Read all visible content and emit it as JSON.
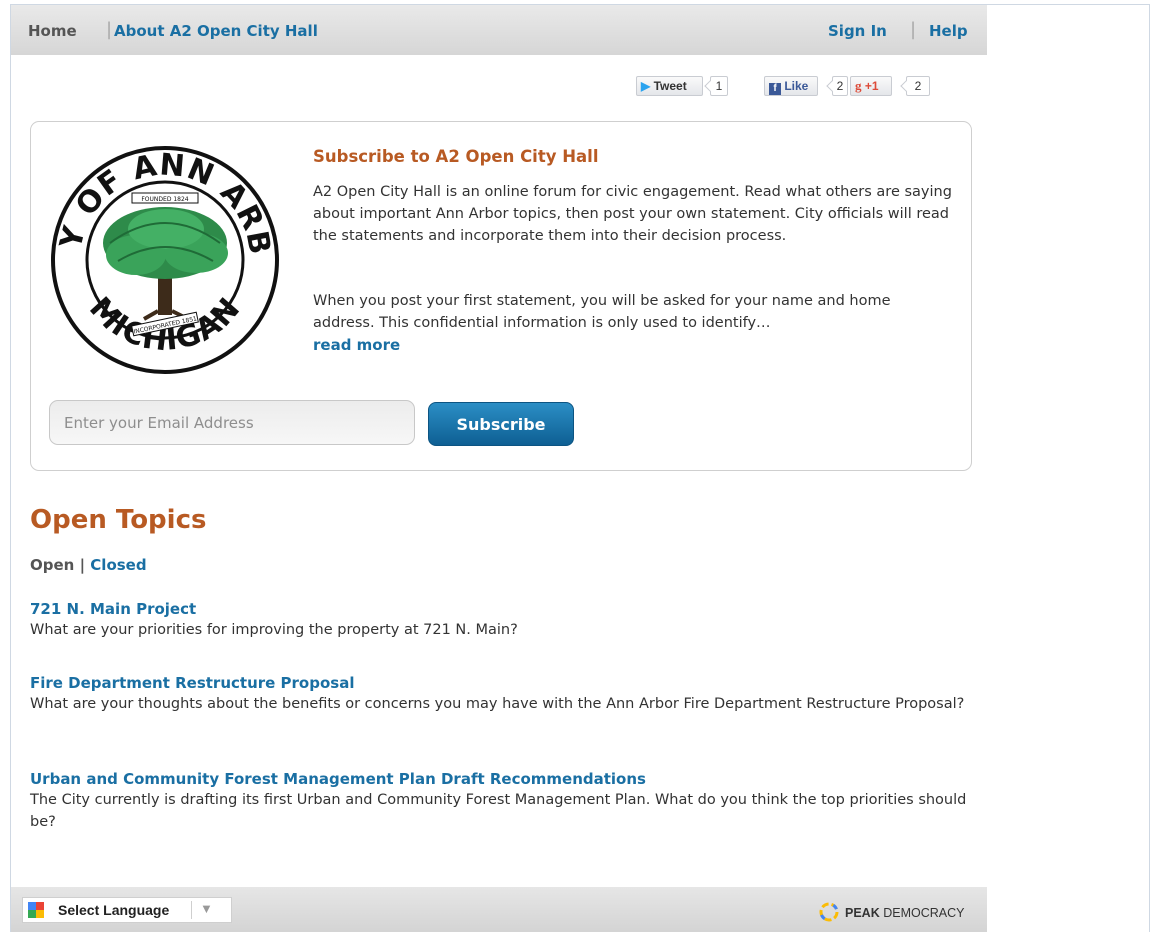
{
  "nav": {
    "home": "Home",
    "about": "About A2 Open City Hall",
    "sign_in": "Sign In",
    "help": "Help",
    "separator": "|"
  },
  "social": {
    "tweet_label": "Tweet",
    "tweet_count": "1",
    "like_label": "Like",
    "like_count": "2",
    "plusone_label": "+1",
    "plusone_count": "2"
  },
  "subscribe": {
    "title": "Subscribe to A2 Open City Hall",
    "paragraph1": "A2 Open City Hall is an online forum for civic engagement. Read what others are saying about important Ann Arbor topics, then post your own statement. City officials will read the statements and incorporate them into their decision process.",
    "paragraph2": "When you post your first statement, you will be asked for your name and home address. This confidential information is only used to identify…",
    "read_more": "read more",
    "email_placeholder": "Enter your Email Address",
    "button_label": "Subscribe",
    "seal": {
      "top_text": "ANN",
      "left_text": "CITY OF",
      "right_text": "ARBOR",
      "bottom_text": "MICHIGAN",
      "founded": "FOUNDED 1824",
      "incorporated": "INCORPORATED 1851"
    }
  },
  "topics": {
    "heading": "Open Topics",
    "filter_open": "Open",
    "filter_sep": "|",
    "filter_closed": "Closed",
    "items": [
      {
        "title": "721 N. Main Project",
        "description": "What are your priorities for improving the property at 721 N. Main?"
      },
      {
        "title": "Fire Department Restructure Proposal",
        "description": "What are your thoughts about the benefits or concerns you may have with the Ann Arbor Fire Department Restructure Proposal?"
      },
      {
        "title": "Urban and Community Forest Management Plan Draft Recommendations",
        "description": "The City currently is drafting its first Urban and Community Forest Management Plan. What do you think the top priorities should be?"
      }
    ]
  },
  "footer": {
    "language_label": "Select Language",
    "brand_strong": "PEAK",
    "brand_rest": "DEMOCRACY"
  },
  "colors": {
    "link_blue": "#1a6fa3",
    "heading_orange": "#b85a23",
    "button_blue": "#1b76ad"
  }
}
